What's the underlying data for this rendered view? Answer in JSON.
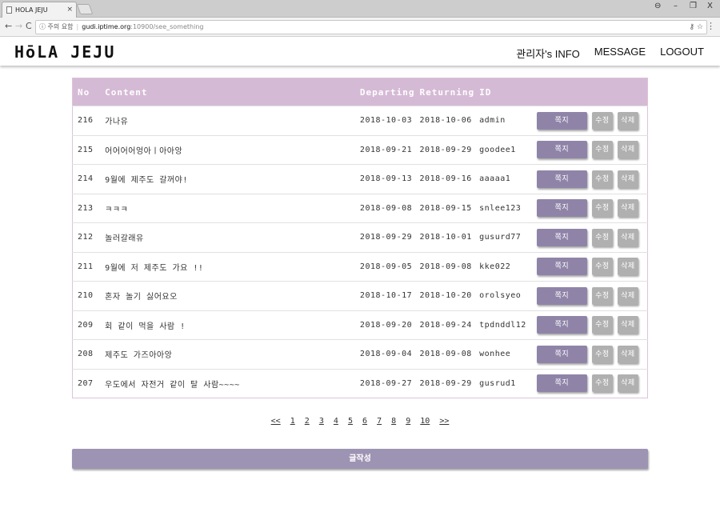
{
  "browser": {
    "tab_title": "HOLA JEJU",
    "tab_close": "×",
    "url_security": "ⓘ 주의 요함",
    "url_host": "gudi.iptime.org",
    "url_path": ":10900/see_something",
    "win_profile": "⊖",
    "win_min": "–",
    "win_max": "❐",
    "win_close": "X",
    "back": "←",
    "forward": "→",
    "reload": "C",
    "key_icon": "⚷",
    "star_icon": "☆",
    "menu": "⋮"
  },
  "header": {
    "logo": "HōLA JEJU",
    "nav": [
      "관리자's INFO",
      "MESSAGE",
      "LOGOUT"
    ]
  },
  "table": {
    "headers": [
      "No",
      "Content",
      "Departing",
      "Returning",
      "ID",
      ""
    ],
    "rows": [
      {
        "no": "216",
        "content": "가나유",
        "departing": "2018-10-03",
        "returning": "2018-10-06",
        "id": "admin"
      },
      {
        "no": "215",
        "content": "어어어어엉아ㅣ아아앙",
        "departing": "2018-09-21",
        "returning": "2018-09-29",
        "id": "goodee1"
      },
      {
        "no": "214",
        "content": "9월에 제주도 갈꺼야!",
        "departing": "2018-09-13",
        "returning": "2018-09-16",
        "id": "aaaaa1"
      },
      {
        "no": "213",
        "content": "ㅋㅋㅋ",
        "departing": "2018-09-08",
        "returning": "2018-09-15",
        "id": "snlee123"
      },
      {
        "no": "212",
        "content": "놀러갈래유",
        "departing": "2018-09-29",
        "returning": "2018-10-01",
        "id": "gusurd77"
      },
      {
        "no": "211",
        "content": "9월에 저 제주도 가요 !!",
        "departing": "2018-09-05",
        "returning": "2018-09-08",
        "id": "kke022"
      },
      {
        "no": "210",
        "content": "혼자 놀기 싫어요오",
        "departing": "2018-10-17",
        "returning": "2018-10-20",
        "id": "orolsyeo"
      },
      {
        "no": "209",
        "content": "회 같이 먹을 사람 !",
        "departing": "2018-09-20",
        "returning": "2018-09-24",
        "id": "tpdnddl12"
      },
      {
        "no": "208",
        "content": "제주도 가즈아아앙",
        "departing": "2018-09-04",
        "returning": "2018-09-08",
        "id": "wonhee"
      },
      {
        "no": "207",
        "content": "우도에서 자전거 같이 탈 사람~~~~",
        "departing": "2018-09-27",
        "returning": "2018-09-29",
        "id": "gusrud1"
      }
    ],
    "action_labels": {
      "message": "쪽지",
      "edit": "수정",
      "delete": "삭제"
    }
  },
  "pagination": {
    "prev": "<<",
    "pages": [
      "1",
      "2",
      "3",
      "4",
      "5",
      "6",
      "7",
      "8",
      "9",
      "10"
    ],
    "next": ">>"
  },
  "write_button": "글작성",
  "colors": {
    "header_bg": "#d5bad5",
    "message_button": "#8f84a8",
    "small_button": "#b0b0b0",
    "write_button": "#9d94b3"
  }
}
